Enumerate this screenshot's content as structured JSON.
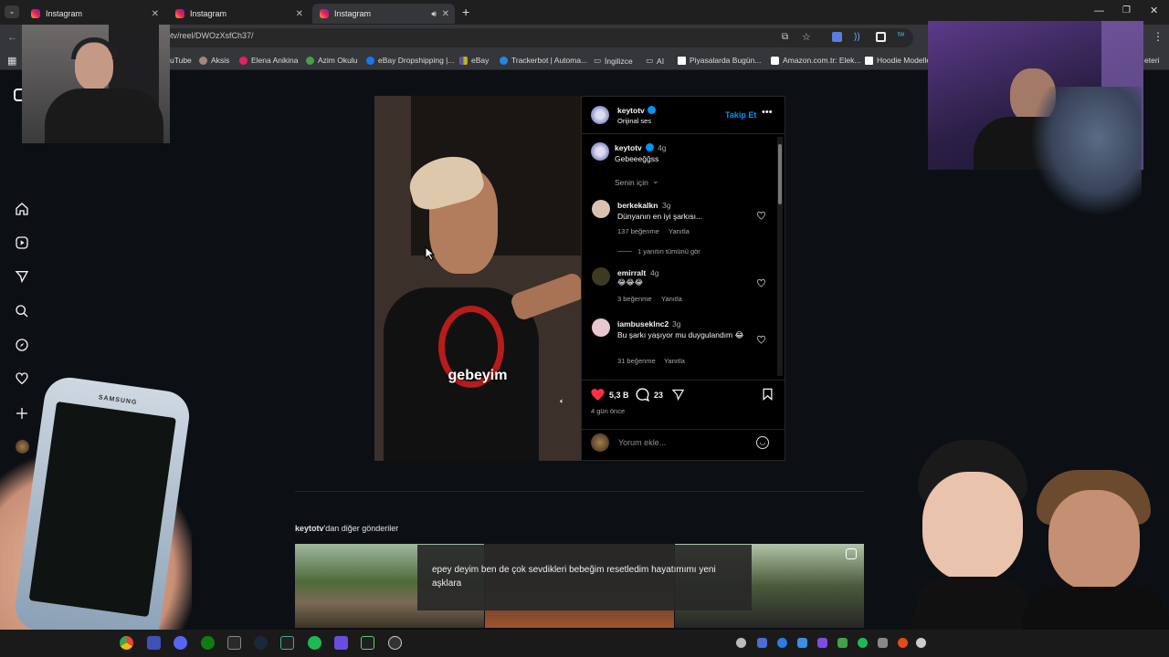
{
  "browser": {
    "tabs": [
      {
        "label": "Instagram"
      },
      {
        "label": "Instagram"
      },
      {
        "label": "Instagram"
      }
    ],
    "url": "otv/reel/DWOzXsfCh37/",
    "bookmarks": [
      {
        "label": "uTube"
      },
      {
        "label": "Aksis"
      },
      {
        "label": "Elena Anikina"
      },
      {
        "label": "Azim Okulu"
      },
      {
        "label": "eBay Dropshipping |..."
      },
      {
        "label": "eBay"
      },
      {
        "label": "Trackerbot | Automa..."
      },
      {
        "label": "İngilizce"
      },
      {
        "label": "AI"
      },
      {
        "label": "Piyasalarda Bugün..."
      },
      {
        "label": "Amazon.com.tr: Elek..."
      },
      {
        "label": "Hoodie Modelle"
      },
      {
        "label": "eteri"
      }
    ]
  },
  "reel": {
    "video_caption": "gebeyim",
    "header": {
      "username": "keytotv",
      "audio": "Orijinal ses",
      "follow": "Takip Et"
    },
    "post": {
      "username": "keytotv",
      "time": "4g",
      "text": "Gebeeeğğss"
    },
    "sort": "Senin için",
    "comments": [
      {
        "username": "berkekalkn",
        "time": "3g",
        "text": "Dünyanın en iyi şarkısı...",
        "likes": "137 beğenme",
        "reply": "Yanıtla"
      },
      {
        "username": "emirralt",
        "time": "4g",
        "text": "😂😂😂",
        "likes": "3 beğenme",
        "reply": "Yanıtla"
      },
      {
        "username": "iambuseklnc2",
        "time": "3g",
        "text": "Bu şarkı yaşıyor mu duygulandım 😂",
        "likes": "31 beğenme",
        "reply": "Yanıtla"
      }
    ],
    "view_replies": "1 yanıtın tümünü gör",
    "like_count": "5,3 B",
    "comment_count": "23",
    "age": "4 gün önce",
    "comment_placeholder": "Yorum ekle..."
  },
  "more": {
    "title_user": "keytotv",
    "title_rest": "'dan diğer gönderiler",
    "subtitle": "epey deyim ben de çok sevdikleri bebeğim resetledim hayatımımı yeni aşklara"
  },
  "phone": {
    "brand": "SAMSUNG"
  },
  "colors": {
    "background": "#0c1014",
    "accent": "#0095f6",
    "like": "#ff3040",
    "panel": "#000000"
  }
}
